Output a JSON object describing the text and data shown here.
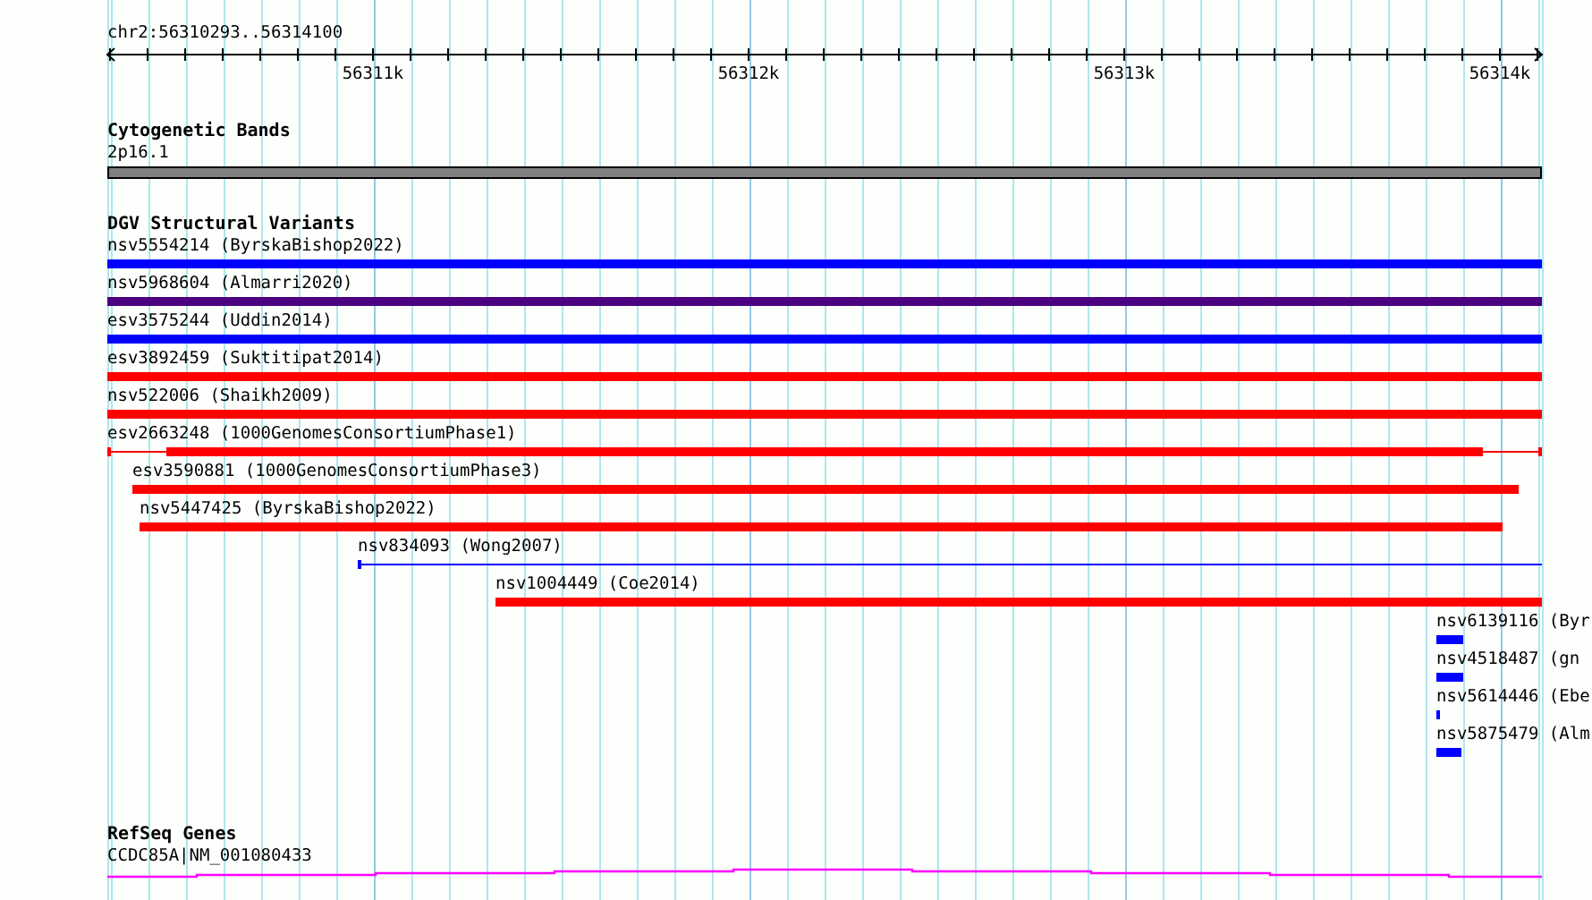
{
  "ruler": {
    "location": "chr2:56310293..56314100",
    "ticks": [
      "56311k",
      "56312k",
      "56313k",
      "56314k"
    ]
  },
  "cytogenetic_bands": {
    "title": "Cytogenetic Bands",
    "band": {
      "label": "2p16.1"
    }
  },
  "structural_variants": {
    "title": "DGV Structural Variants",
    "features": [
      {
        "label": "nsv5554214 (ByrskaBishop2022)",
        "color": "#0000ff"
      },
      {
        "label": "nsv5968604 (Almarri2020)",
        "color": "#4b0082"
      },
      {
        "label": "esv3575244 (Uddin2014)",
        "color": "#0000ff"
      },
      {
        "label": "esv3892459 (Suktitipat2014)",
        "color": "#ff0000"
      },
      {
        "label": "nsv522006 (Shaikh2009)",
        "color": "#ff0000"
      },
      {
        "label": "esv2663248 (1000GenomesConsortiumPhase1)",
        "color": "#ff0000"
      },
      {
        "label": "esv3590881 (1000GenomesConsortiumPhase3)",
        "color": "#ff0000"
      },
      {
        "label": "nsv5447425 (ByrskaBishop2022)",
        "color": "#ff0000"
      },
      {
        "label": "nsv834093 (Wong2007)",
        "color": "#0000ff"
      },
      {
        "label": "nsv1004449 (Coe2014)",
        "color": "#ff0000"
      },
      {
        "label": "nsv6139116 (Byr",
        "color": "#0000ff"
      },
      {
        "label": "nsv4518487 (gn",
        "color": "#0000ff"
      },
      {
        "label": "nsv5614446 (Ebe",
        "color": "#0000ff"
      },
      {
        "label": "nsv5875479 (Alm",
        "color": "#0000ff"
      }
    ]
  },
  "refseq_genes": {
    "title": "RefSeq Genes",
    "gene": {
      "label": "CCDC85A|NM_001080433"
    }
  }
}
